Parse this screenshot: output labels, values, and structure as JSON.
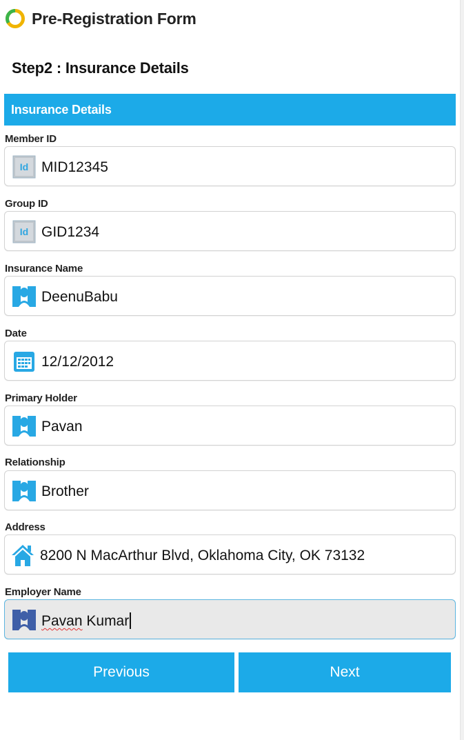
{
  "app": {
    "title": "Pre-Registration Form"
  },
  "step": {
    "title": "Step2 : Insurance Details"
  },
  "section": {
    "title": "Insurance Details"
  },
  "fields": [
    {
      "label": "Member ID",
      "value": "MID12345",
      "icon": "id-card-icon"
    },
    {
      "label": "Group ID",
      "value": "GID1234",
      "icon": "id-card-icon"
    },
    {
      "label": "Insurance Name",
      "value": "DeenuBabu",
      "icon": "person-icon"
    },
    {
      "label": "Date",
      "value": "12/12/2012",
      "icon": "calendar-icon"
    },
    {
      "label": "Primary Holder",
      "value": "Pavan",
      "icon": "person-icon"
    },
    {
      "label": "Relationship",
      "value": "Brother",
      "icon": "person-icon"
    },
    {
      "label": "Address",
      "value": "8200 N MacArthur Blvd, Oklahoma City, OK 73132",
      "icon": "home-icon"
    },
    {
      "label": "Employer Name",
      "value_part1": "Pavan",
      "value_part2": " Kumar",
      "icon": "person-icon"
    }
  ],
  "buttons": {
    "previous": "Previous",
    "next": "Next"
  },
  "colors": {
    "accent": "#1caae8",
    "id_icon_text": "#2fa6e0",
    "person_icon": "#28a8e4",
    "person_icon_active": "#3f5fa8",
    "spell_error": "#e03030"
  }
}
